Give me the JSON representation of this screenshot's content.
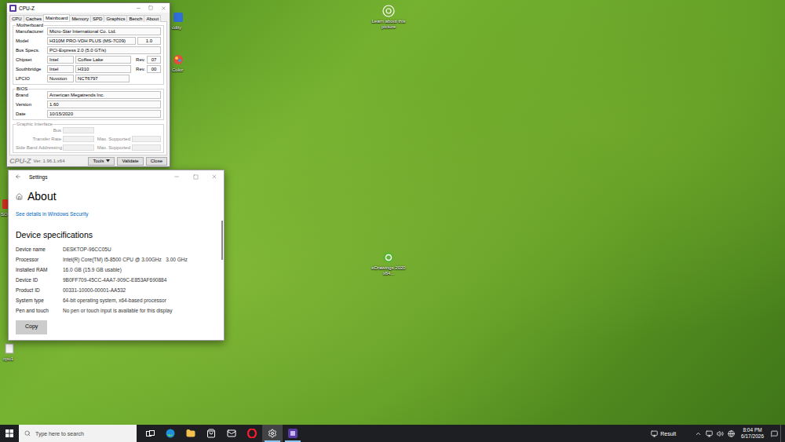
{
  "desktop": {
    "icons": [
      {
        "label": "cdity"
      },
      {
        "label": "Color"
      },
      {
        "label": "Learn about this picture"
      },
      {
        "label": "eDrawings 2020 x64..."
      },
      {
        "label": "SOL"
      },
      {
        "label": "cpu1"
      }
    ]
  },
  "cpuz": {
    "title": "CPU-Z",
    "tabs": [
      {
        "label": "CPU",
        "selected": false
      },
      {
        "label": "Caches",
        "selected": false
      },
      {
        "label": "Mainboard",
        "selected": true
      },
      {
        "label": "Memory",
        "selected": false
      },
      {
        "label": "SPD",
        "selected": false
      },
      {
        "label": "Graphics",
        "selected": false
      },
      {
        "label": "Bench",
        "selected": false
      },
      {
        "label": "About",
        "selected": false
      }
    ],
    "motherboard": {
      "legend": "Motherboard",
      "rows": [
        {
          "kind": "single",
          "label": "Manufacturer",
          "cells": [
            "Micro-Star International Co. Ltd."
          ]
        },
        {
          "kind": "model",
          "label": "Model",
          "cells": [
            "H310M PRO-VDH PLUS (MS-7C09)",
            "1.0"
          ]
        },
        {
          "kind": "single",
          "label": "Bus Specs.",
          "cells": [
            "PCI-Express 2.0 (5.0 GT/s)"
          ]
        },
        {
          "kind": "rev",
          "label": "Chipset",
          "cells": [
            "Intel",
            "Coffee Lake"
          ],
          "rev_label": "Rev.",
          "rev": "07"
        },
        {
          "kind": "rev",
          "label": "Southbridge",
          "cells": [
            "Intel",
            "H310"
          ],
          "rev_label": "Rev.",
          "rev": "00"
        },
        {
          "kind": "pair",
          "label": "LPCIO",
          "cells": [
            "Nuvoton",
            "NCT6797"
          ]
        }
      ]
    },
    "bios": {
      "legend": "BIOS",
      "rows": [
        {
          "kind": "single",
          "label": "Brand",
          "cells": [
            "American Megatrends Inc."
          ]
        },
        {
          "kind": "single",
          "label": "Version",
          "cells": [
            "1.60"
          ]
        },
        {
          "kind": "single",
          "label": "Date",
          "cells": [
            "10/15/2020"
          ]
        }
      ]
    },
    "graphic": {
      "legend": "Graphic Interface",
      "disabled": true,
      "rows": [
        {
          "kind": "single",
          "label": "Bus"
        },
        {
          "kind": "double",
          "label": "Transfer Rate",
          "right_label": "Max. Supported"
        },
        {
          "kind": "double",
          "label": "Side Band Addressing",
          "right_label": "Max. Supported"
        }
      ]
    },
    "footer": {
      "brand": "CPU-Z",
      "version": "Ver. 1.96.1.x64",
      "buttons": [
        {
          "label": "Tools",
          "menu": true
        },
        {
          "label": "Validate",
          "menu": false
        },
        {
          "label": "Close",
          "menu": false
        }
      ]
    }
  },
  "settings": {
    "title": "Settings",
    "heading": "About",
    "link": "See details in Windows Security",
    "section": "Device specifications",
    "specs": [
      {
        "label": "Device name",
        "value": "DESKTOP-96CC05U"
      },
      {
        "label": "Processor",
        "value": "Intel(R) Core(TM) i5-8500 CPU @ 3.00GHz   3.00 GHz"
      },
      {
        "label": "Installed RAM",
        "value": "16.0 GB (15.9 GB usable)"
      },
      {
        "label": "Device ID",
        "value": "9B0FF709-45CC-4AA7-909C-E853AF690884"
      },
      {
        "label": "Product ID",
        "value": "00331-10000-00001-AA532"
      },
      {
        "label": "System type",
        "value": "64-bit operating system, x64-based processor"
      },
      {
        "label": "Pen and touch",
        "value": "No pen or touch input is available for this display"
      }
    ],
    "button": "Copy"
  },
  "taskbar": {
    "search": {
      "placeholder": "Type here to search"
    },
    "apps": [
      {
        "kind": "taskview",
        "active": false,
        "focused": false
      },
      {
        "kind": "edge",
        "active": false,
        "focused": false
      },
      {
        "kind": "explorer",
        "active": false,
        "focused": false
      },
      {
        "kind": "store",
        "active": false,
        "focused": false
      },
      {
        "kind": "mail",
        "active": false,
        "focused": false
      },
      {
        "kind": "opera",
        "active": false,
        "focused": false
      },
      {
        "kind": "settings",
        "active": true,
        "focused": true
      },
      {
        "kind": "cpuz",
        "active": true,
        "focused": false
      }
    ],
    "tray": {
      "result": "Result",
      "time": "8:04 PM",
      "date": "6/17/2026"
    }
  }
}
